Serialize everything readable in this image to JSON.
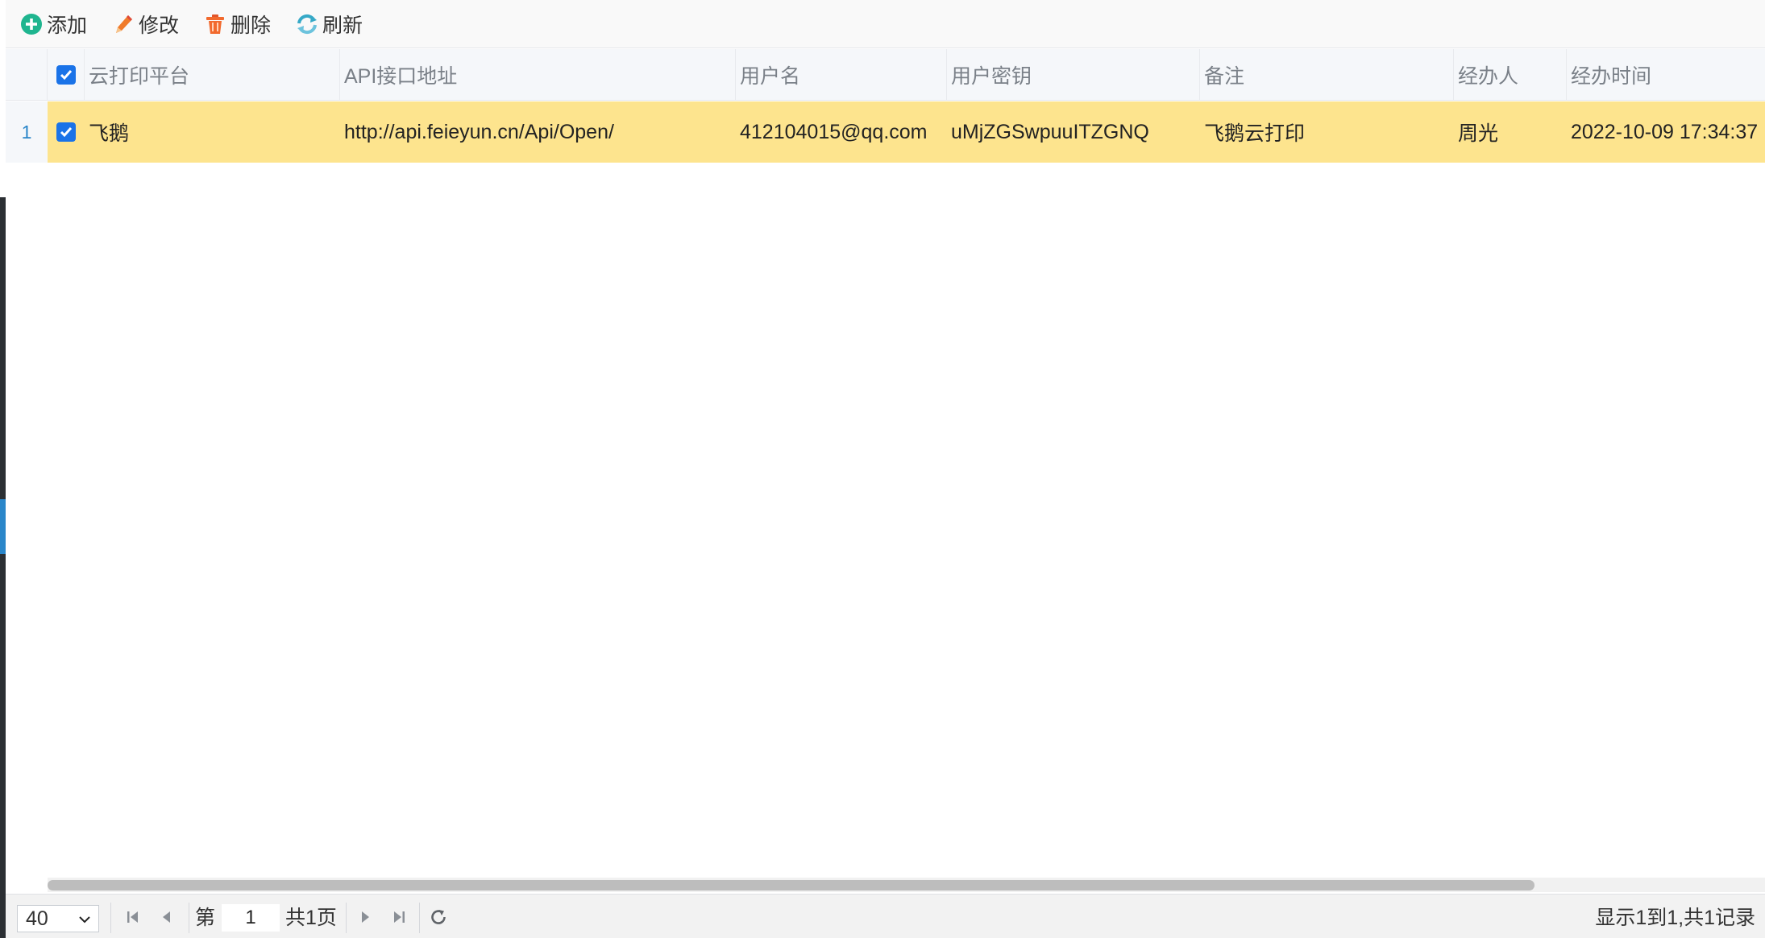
{
  "toolbar": {
    "add_label": "添加",
    "edit_label": "修改",
    "delete_label": "删除",
    "refresh_label": "刷新"
  },
  "columns": [
    "云打印平台",
    "API接口地址",
    "用户名",
    "用户密钥",
    "备注",
    "经办人",
    "经办时间"
  ],
  "rows": [
    {
      "row_number": "1",
      "selected": true,
      "cells": [
        "飞鹅",
        "http://api.feieyun.cn/Api/Open/",
        "412104015@qq.com",
        "uMjZGSwpuuITZGNQ",
        "飞鹅云打印",
        "周光",
        "2022-10-09 17:34:37"
      ]
    }
  ],
  "header_checkbox_checked": true,
  "pager": {
    "page_size": "40",
    "page_prefix": "第",
    "current_page": "1",
    "total_pages_text": "共1页",
    "summary": "显示1到1,共1记录"
  },
  "colors": {
    "selected_row": "#fde48e",
    "checkbox": "#1a73e8",
    "row_number": "#2a86c9",
    "add_icon": "#1fb58f",
    "refresh_icon": "#36a9c7",
    "delete_icon": "#f26a2e"
  },
  "icons": [
    "add-icon",
    "edit-icon",
    "delete-icon",
    "refresh-icon",
    "first-page-icon",
    "prev-page-icon",
    "next-page-icon",
    "last-page-icon",
    "reload-icon"
  ]
}
